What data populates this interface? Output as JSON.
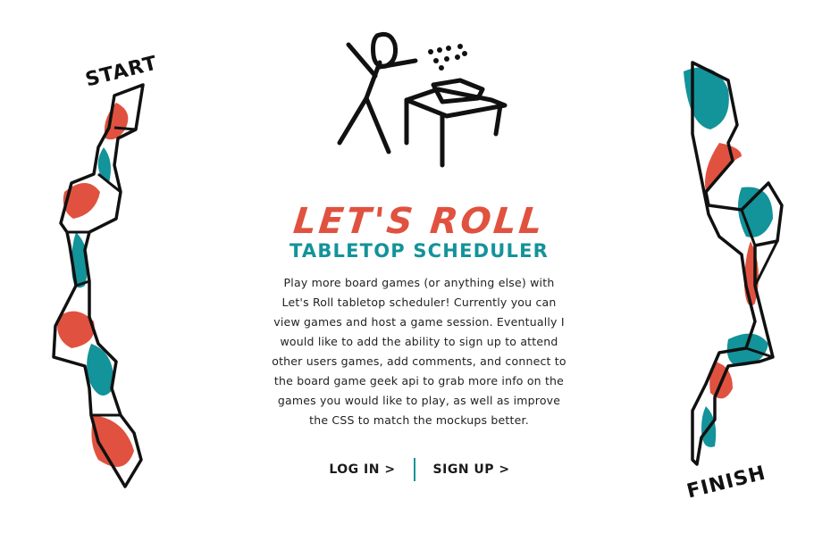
{
  "labels": {
    "start": "START",
    "finish": "FINISH"
  },
  "hero": {
    "title": "LET'S ROLL",
    "subtitle": "TABLETOP SCHEDULER",
    "description": "Play more board games (or anything else) with Let's Roll tabletop scheduler! Currently you can view games and host a game session. Eventually I would like to add the ability to sign up to attend other users games, add comments, and connect to the board game geek api to grab more info on the games you would like to play, as well as improve the CSS to match the mockups better."
  },
  "actions": {
    "login": "LOG IN >",
    "signup": "SIGN UP >"
  },
  "icons": {
    "hero": "person-rolling-dice-icon",
    "left": "board-game-path-icon",
    "right": "board-game-path-icon"
  },
  "colors": {
    "red": "#e0523f",
    "teal": "#13939a",
    "ink": "#111111"
  }
}
